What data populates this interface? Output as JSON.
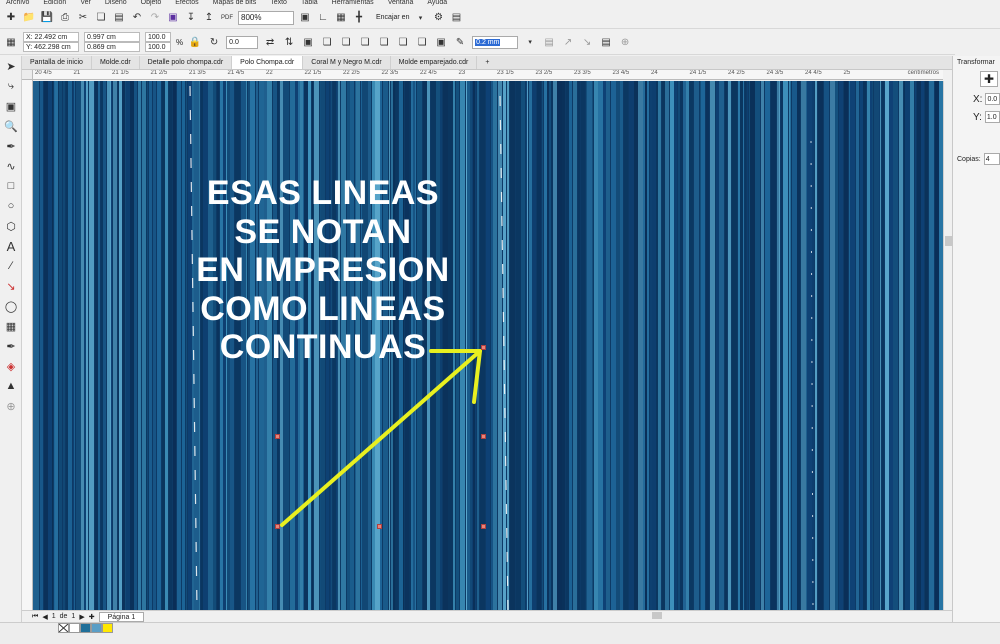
{
  "menu": {
    "items": [
      "Archivo",
      "Edición",
      "Ver",
      "Diseño",
      "Objeto",
      "Efectos",
      "Mapas de bits",
      "Texto",
      "Tabla",
      "Herramientas",
      "Ventana",
      "Ayuda"
    ]
  },
  "toolbar": {
    "zoom_value": "800%",
    "snap_label": "Encajar en"
  },
  "property_bar": {
    "x": "X: 22.492 cm",
    "y": "Y: 462.298 cm",
    "width": "0.997 cm",
    "height": "0.869 cm",
    "scale_x": "100.0",
    "scale_y": "100.0",
    "percent": "%",
    "rotation": "0.0",
    "outline_width": "0.2 mm"
  },
  "tabs": [
    {
      "label": "Pantalla de inicio",
      "active": false
    },
    {
      "label": "Molde.cdr",
      "active": false
    },
    {
      "label": "Detalle polo chompa.cdr",
      "active": false
    },
    {
      "label": "Polo Chompa.cdr",
      "active": true
    },
    {
      "label": "Coral M y Negro M.cdr",
      "active": false
    },
    {
      "label": "Molde emparejado.cdr",
      "active": false
    }
  ],
  "ruler": {
    "units": "centímetros",
    "ticks": [
      "20 4/5",
      "21",
      "21 1/5",
      "21 2/5",
      "21 3/5",
      "21 4/5",
      "22",
      "22 1/5",
      "22 2/5",
      "22 3/5",
      "22 4/5",
      "23",
      "23 1/5",
      "23 2/5",
      "23 3/5",
      "23 4/5",
      "24",
      "24 1/5",
      "24 2/5",
      "24 3/5",
      "24 4/5",
      "25"
    ]
  },
  "annotation": {
    "lines": [
      "ESAS LINEAS",
      "SE NOTAN",
      "EN IMPRESION",
      "COMO LINEAS",
      "CONTINUAS"
    ],
    "arrow_color": "#e8f020"
  },
  "page_nav": {
    "current": "1",
    "separator": "de",
    "total": "1",
    "page_label": "Página 1"
  },
  "docker": {
    "title": "Transformar",
    "x_label": "X:",
    "x_value": "0.0",
    "y_label": "Y:",
    "y_value": "1.0",
    "copies_label": "Copias:",
    "copies_value": "4"
  },
  "colors": {
    "canvas_dark": "#0d3a66",
    "canvas_mid": "#1e6699",
    "canvas_light": "#3f93bd",
    "accent": "#2d6bd4"
  },
  "palette": [
    "#ffffff",
    "#1f6f99",
    "#5a9ec6",
    "#ffe800"
  ]
}
